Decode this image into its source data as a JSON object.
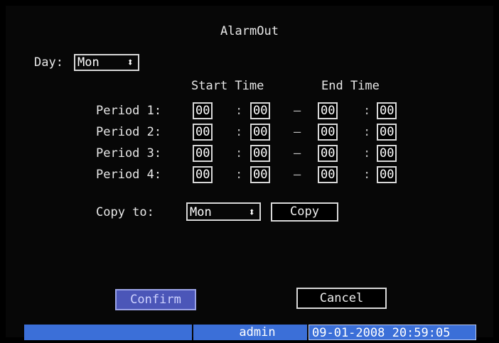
{
  "title": "AlarmOut",
  "day": {
    "label": "Day:",
    "value": "Mon"
  },
  "headers": {
    "start": "Start Time",
    "end": "End Time"
  },
  "periods": [
    {
      "label": "Period 1:",
      "start_h": "00",
      "start_m": "00",
      "end_h": "00",
      "end_m": "00"
    },
    {
      "label": "Period 2:",
      "start_h": "00",
      "start_m": "00",
      "end_h": "00",
      "end_m": "00"
    },
    {
      "label": "Period 3:",
      "start_h": "00",
      "start_m": "00",
      "end_h": "00",
      "end_m": "00"
    },
    {
      "label": "Period 4:",
      "start_h": "00",
      "start_m": "00",
      "end_h": "00",
      "end_m": "00"
    }
  ],
  "separators": {
    "colon": ":",
    "dash": "—"
  },
  "copy": {
    "label": "Copy to:",
    "value": "Mon",
    "button": "Copy"
  },
  "buttons": {
    "confirm": "Confirm",
    "cancel": "Cancel"
  },
  "statusbar": {
    "user": "admin",
    "datetime": "09-01-2008 20:59:05"
  },
  "icons": {
    "spinner": "up-down-arrows-icon"
  },
  "colors": {
    "status_bg": "#3b6fd8",
    "confirm_bg": "#4b56b8"
  }
}
